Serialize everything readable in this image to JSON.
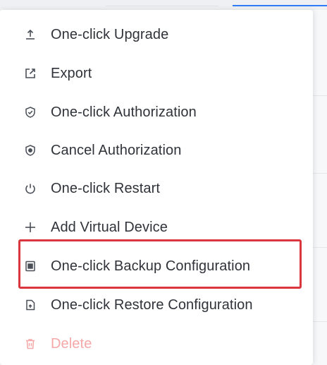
{
  "menu": {
    "items": [
      {
        "label": "One-click Upgrade",
        "icon": "upload-icon"
      },
      {
        "label": "Export",
        "icon": "export-icon"
      },
      {
        "label": "One-click Authorization",
        "icon": "shield-check-icon"
      },
      {
        "label": "Cancel Authorization",
        "icon": "shield-cancel-icon"
      },
      {
        "label": "One-click Restart",
        "icon": "power-icon"
      },
      {
        "label": "Add Virtual Device",
        "icon": "plus-icon"
      },
      {
        "label": "One-click Backup Configuration",
        "icon": "backup-file-icon"
      },
      {
        "label": "One-click Restore Configuration",
        "icon": "restore-file-icon"
      },
      {
        "label": "Delete",
        "icon": "trash-icon",
        "disabled": true
      }
    ],
    "highlighted_item": "One-click Backup Configuration"
  },
  "colors": {
    "text": "#2f3339",
    "icon": "#4a4f57",
    "disabled": "#f4a8a8",
    "highlight_border": "#d9363e",
    "accent": "#2f7cf6"
  }
}
